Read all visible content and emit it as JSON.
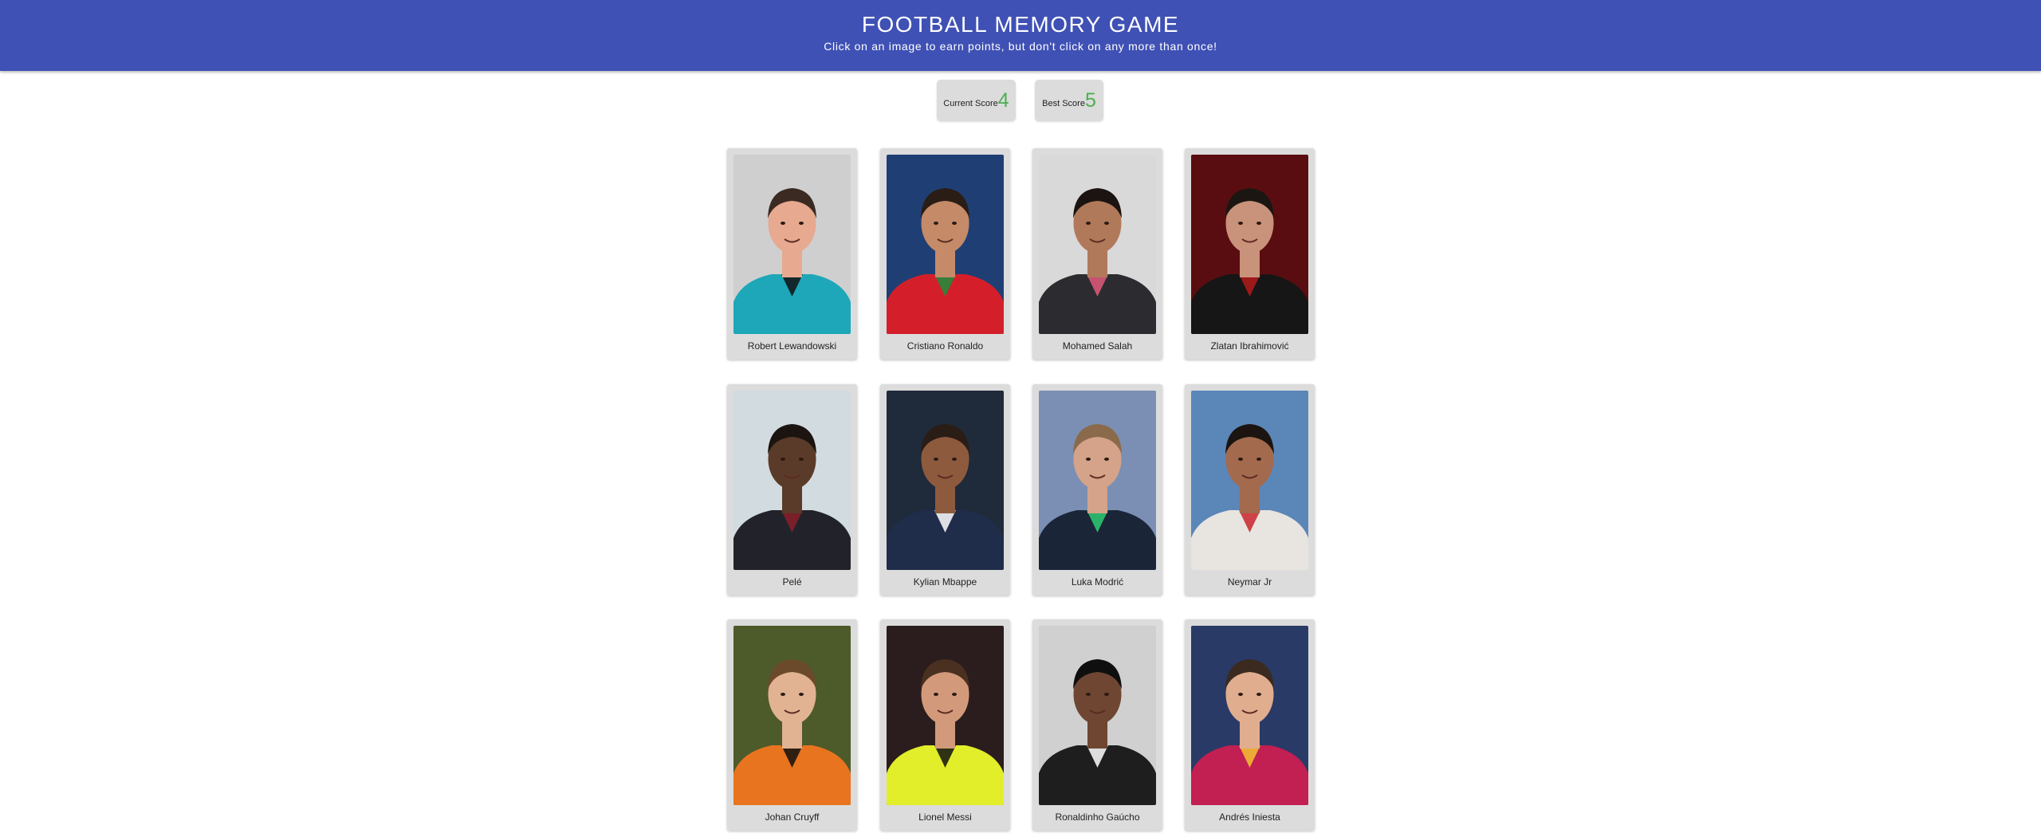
{
  "header": {
    "title": "FOOTBALL MEMORY GAME",
    "subtitle": "Click on an image to earn points, but don't click on any more than once!"
  },
  "scores": {
    "current_label": "Current Score",
    "current_value": "4",
    "best_label": "Best Score",
    "best_value": "5"
  },
  "colors": {
    "header_bg": "#3f51b5",
    "score_value": "#4caf50",
    "card_bg": "#dcdcdc"
  },
  "cards": [
    {
      "name": "Robert Lewandowski",
      "bg": "#cfcfcf",
      "skin": "#e7a98f",
      "hair": "#3a2a22",
      "shirt": "#1da7b8",
      "accent": "#111111"
    },
    {
      "name": "Cristiano Ronaldo",
      "bg": "#1f3f74",
      "skin": "#c58a68",
      "hair": "#2a1d16",
      "shirt": "#d41f2a",
      "accent": "#1a8f3c"
    },
    {
      "name": "Mohamed Salah",
      "bg": "#d9d9d9",
      "skin": "#b0795a",
      "hair": "#1b1410",
      "shirt": "#2c2c30",
      "accent": "#e05a7a"
    },
    {
      "name": "Zlatan Ibrahimović",
      "bg": "#5a0d10",
      "skin": "#c9927a",
      "hair": "#1c1612",
      "shirt": "#161616",
      "accent": "#b31a1a"
    },
    {
      "name": "Pelé",
      "bg": "#d2dbe0",
      "skin": "#5a3a28",
      "hair": "#1b1410",
      "shirt": "#22232a",
      "accent": "#8a1f2a"
    },
    {
      "name": "Kylian Mbappe",
      "bg": "#1f2a3a",
      "skin": "#8d5a3e",
      "hair": "#2a1d16",
      "shirt": "#1f2d4a",
      "accent": "#ffffff"
    },
    {
      "name": "Luka Modrić",
      "bg": "#7a8fb3",
      "skin": "#d4a389",
      "hair": "#8a6a4a",
      "shirt": "#1a2538",
      "accent": "#2ecc71"
    },
    {
      "name": "Neymar Jr",
      "bg": "#5b86b8",
      "skin": "#a36a4e",
      "hair": "#1b1410",
      "shirt": "#e8e4e0",
      "accent": "#c8262c"
    },
    {
      "name": "Johan Cruyff",
      "bg": "#4d5a2a",
      "skin": "#e1b393",
      "hair": "#6a4a2a",
      "shirt": "#e8741f",
      "accent": "#111111"
    },
    {
      "name": "Lionel Messi",
      "bg": "#2b1d1d",
      "skin": "#d29a7a",
      "hair": "#4a3020",
      "shirt": "#e2ee2a",
      "accent": "#111111"
    },
    {
      "name": "Ronaldinho Gaúcho",
      "bg": "#d0d0d0",
      "skin": "#6e4632",
      "hair": "#0f0f0f",
      "shirt": "#1e1e1e",
      "accent": "#ffffff"
    },
    {
      "name": "Andrés Iniesta",
      "bg": "#2a3a66",
      "skin": "#e0ad8e",
      "hair": "#3a2a20",
      "shirt": "#c21f52",
      "accent": "#f2c331"
    }
  ]
}
